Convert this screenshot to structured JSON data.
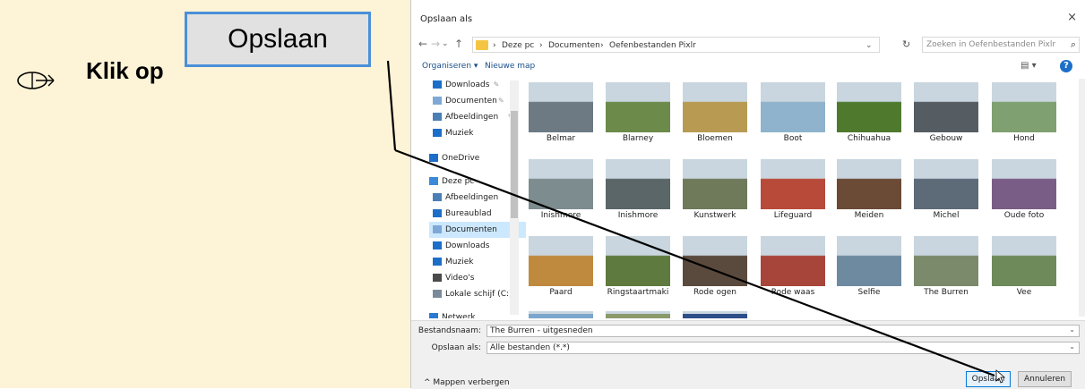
{
  "instruction": {
    "text": "Klik op",
    "button_label": "Opslaan"
  },
  "dialog": {
    "title": "Opslaan als",
    "close": "×",
    "nav": {
      "back": "←",
      "forward": "→",
      "recent": "⌄",
      "up": "↑"
    },
    "breadcrumb": [
      "Deze pc",
      "Documenten",
      "Oefenbestanden Pixlr"
    ],
    "breadcrumb_sep": "›",
    "refresh": "↻",
    "search_placeholder": "Zoeken in Oefenbestanden Pixlr",
    "toolbar": {
      "organize": "Organiseren ▾",
      "new_folder": "Nieuwe map",
      "view": "▤ ▾",
      "help": "?"
    },
    "nav_pane": [
      {
        "label": "Downloads",
        "icon": "download-icon",
        "pinned": true
      },
      {
        "label": "Documenten",
        "icon": "document-icon",
        "pinned": true
      },
      {
        "label": "Afbeeldingen",
        "icon": "pictures-icon",
        "pinned": true
      },
      {
        "label": "Muziek",
        "icon": "music-icon",
        "pinned": false
      },
      {
        "label": "OneDrive",
        "icon": "cloud-icon",
        "pinned": false
      },
      {
        "label": "Deze pc",
        "icon": "computer-icon",
        "pinned": false
      },
      {
        "label": "Afbeeldingen",
        "icon": "pictures-icon",
        "pinned": false
      },
      {
        "label": "Bureaublad",
        "icon": "desktop-icon",
        "pinned": false
      },
      {
        "label": "Documenten",
        "icon": "document-icon",
        "pinned": false,
        "selected": true
      },
      {
        "label": "Downloads",
        "icon": "download-icon",
        "pinned": false
      },
      {
        "label": "Muziek",
        "icon": "music-icon",
        "pinned": false
      },
      {
        "label": "Video's",
        "icon": "video-icon",
        "pinned": false
      },
      {
        "label": "Lokale schijf (C:)",
        "icon": "drive-icon",
        "pinned": false
      },
      {
        "label": "Netwerk",
        "icon": "network-icon",
        "pinned": false
      }
    ],
    "pin_glyph": "✎",
    "files": [
      {
        "name": "Belmar",
        "color": "#6d7a84"
      },
      {
        "name": "Blarney",
        "color": "#6c8a4a"
      },
      {
        "name": "Bloemen",
        "color": "#b89a52"
      },
      {
        "name": "Boot",
        "color": "#8fb3cc"
      },
      {
        "name": "Chihuahua",
        "color": "#4f7a2e"
      },
      {
        "name": "Gebouw",
        "color": "#555d63"
      },
      {
        "name": "Hond",
        "color": "#7fa070"
      },
      {
        "name": "Inishmore",
        "color": "#7d8c8f"
      },
      {
        "name": "Inishmore",
        "color": "#5a6668"
      },
      {
        "name": "Kunstwerk",
        "color": "#6e7a5a"
      },
      {
        "name": "Lifeguard",
        "color": "#b84a3a"
      },
      {
        "name": "Meiden",
        "color": "#6b4a36"
      },
      {
        "name": "Michel",
        "color": "#5d6a78"
      },
      {
        "name": "Oude foto",
        "color": "#7a5d86"
      },
      {
        "name": "Paard",
        "color": "#c08a3e"
      },
      {
        "name": "Ringstaartmaki",
        "color": "#5f7a3e"
      },
      {
        "name": "Rode ogen",
        "color": "#5a4a3e"
      },
      {
        "name": "Rode waas",
        "color": "#a8453a"
      },
      {
        "name": "Selfie",
        "color": "#6e8aa0"
      },
      {
        "name": "The Burren",
        "color": "#7a8a6a"
      },
      {
        "name": "Vee",
        "color": "#6e8a5a"
      },
      {
        "name": "",
        "color": "#7aa6cc"
      },
      {
        "name": "",
        "color": "#8a9a6a"
      },
      {
        "name": "",
        "color": "#2e4e8a"
      }
    ],
    "form": {
      "filename_label": "Bestandsnaam:",
      "filename_value": "The Burren - uitgesneden",
      "type_label": "Opslaan als:",
      "type_value": "Alle bestanden (*.*)",
      "dropdown_glyph": "⌄",
      "hide_folders": "Mappen verbergen",
      "hide_folders_glyph": "^",
      "save": "Opslaan",
      "cancel": "Annuleren"
    }
  }
}
